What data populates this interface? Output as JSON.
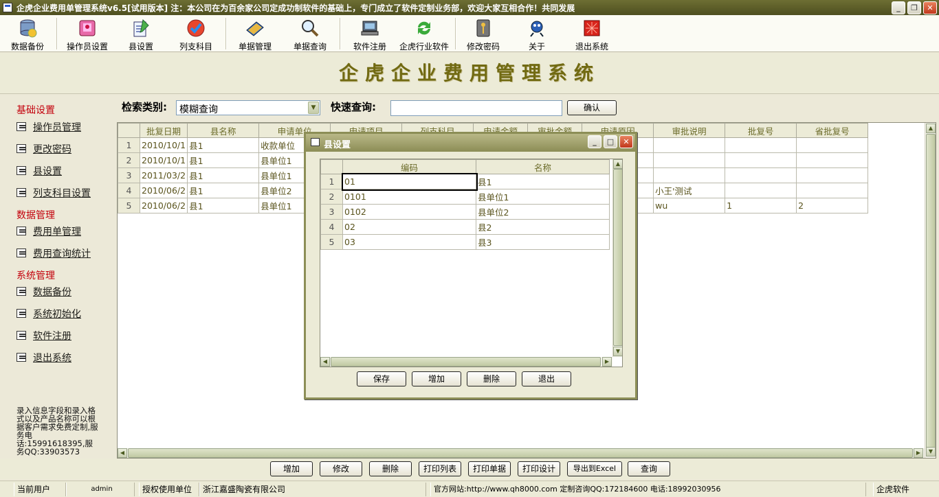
{
  "window": {
    "title": "企虎企业费用单管理系统v6.5[试用版本]   注：本公司在为百余家公司定成功制软件的基础上，专门成立了软件定制业务部，欢迎大家互相合作！共同发展"
  },
  "toolbar": {
    "items": [
      {
        "label": "数据备份",
        "icon": "database-icon"
      },
      {
        "label": "操作员设置",
        "icon": "operator-icon"
      },
      {
        "label": "县设置",
        "icon": "county-icon"
      },
      {
        "label": "列支科目",
        "icon": "subject-icon"
      },
      {
        "label": "单据管理",
        "icon": "document-icon"
      },
      {
        "label": "单据查询",
        "icon": "magnifier-icon"
      },
      {
        "label": "软件注册",
        "icon": "register-icon"
      },
      {
        "label": "企虎行业软件",
        "icon": "refresh-icon"
      },
      {
        "label": "修改密码",
        "icon": "key-icon"
      },
      {
        "label": "关于",
        "icon": "about-icon"
      },
      {
        "label": "退出系统",
        "icon": "exit-icon"
      }
    ]
  },
  "banner": {
    "title": "企虎企业费用管理系统"
  },
  "leftnav": {
    "sections": [
      {
        "title": "基础设置",
        "items": [
          "操作员管理",
          "更改密码",
          "县设置",
          "列支科目设置"
        ]
      },
      {
        "title": "数据管理",
        "items": [
          "费用单管理",
          "费用查询统计"
        ]
      },
      {
        "title": "系统管理",
        "items": [
          "数据备份",
          "系统初始化",
          "软件注册",
          "退出系统"
        ]
      }
    ],
    "note": "录入信息字段和录入格式以及产品名称可以根据客户需求免费定制,服务电话:15991618395,服务QQ:33903573"
  },
  "search": {
    "category_label": "检索类别:",
    "category_value": "模糊查询",
    "quick_label": "快速查询:",
    "quick_value": "",
    "confirm_label": "确认"
  },
  "main_table": {
    "columns": [
      "批复日期",
      "县名称",
      "申请单位",
      "申请项目",
      "列支科目",
      "申请金额",
      "审批金额",
      "申请原因",
      "审批说明",
      "批复号",
      "省批复号"
    ],
    "rows": [
      {
        "n": "1",
        "cells": [
          "2010/10/1",
          "县1",
          "收款单位",
          "",
          "",
          "",
          "",
          "",
          "",
          "",
          ""
        ]
      },
      {
        "n": "2",
        "cells": [
          "2010/10/1",
          "县1",
          "县单位1",
          "",
          "",
          "",
          "",
          "",
          "",
          "",
          ""
        ]
      },
      {
        "n": "3",
        "cells": [
          "2011/03/2",
          "县1",
          "县单位1",
          "",
          "",
          "",
          "",
          "",
          "",
          "",
          ""
        ]
      },
      {
        "n": "4",
        "cells": [
          "2010/06/2",
          "县1",
          "县单位2",
          "",
          "",
          "",
          "",
          "",
          "小王'测试",
          "",
          ""
        ]
      },
      {
        "n": "5",
        "cells": [
          "2010/06/2",
          "县1",
          "县单位1",
          "",
          "",
          "",
          "",
          "",
          "wu",
          "1",
          "2"
        ]
      }
    ]
  },
  "dialog": {
    "title": "县设置",
    "columns": [
      "编码",
      "名称"
    ],
    "rows": [
      {
        "n": "1",
        "code": "01",
        "name": "县1"
      },
      {
        "n": "2",
        "code": "0101",
        "name": "县单位1"
      },
      {
        "n": "3",
        "code": "0102",
        "name": "县单位2"
      },
      {
        "n": "4",
        "code": "02",
        "name": "县2"
      },
      {
        "n": "5",
        "code": "03",
        "name": "县3"
      }
    ],
    "buttons": {
      "save": "保存",
      "add": "增加",
      "delete": "删除",
      "exit": "退出"
    }
  },
  "bottom_buttons": [
    "增加",
    "修改",
    "删除",
    "打印列表",
    "打印单据",
    "打印设计",
    "导出到Excel",
    "查询"
  ],
  "status": {
    "user_label": "当前用户",
    "user": "admin",
    "unit_label": "授权使用单位",
    "unit": "浙江嘉盛陶瓷有限公司",
    "site": "官方网站:http://www.qh8000.com 定制咨询QQ:172184600 电话:18992030956",
    "brand": "企虎软件"
  },
  "colors": {
    "accent": "#716a12",
    "section": "#c3000b",
    "titlebar": "#5d5e2a"
  }
}
